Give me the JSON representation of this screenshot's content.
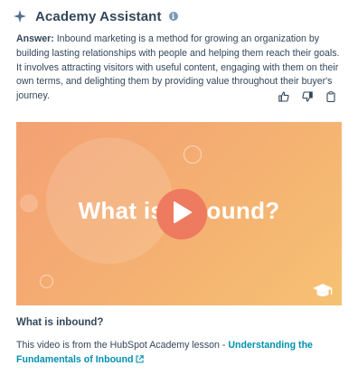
{
  "header": {
    "title": "Academy Assistant",
    "icon": "sparkle-icon",
    "info_icon": "info-icon"
  },
  "answer": {
    "label": "Answer:",
    "text": " Inbound marketing is a method for growing an organization by building lasting relationships with people and helping them reach their goals. It involves attracting visitors with useful content, engaging with them on their own terms, and delighting them by providing value throughout their buyer's journey."
  },
  "feedback": {
    "icons": [
      "thumbs-up-icon",
      "thumbs-down-icon",
      "copy-icon"
    ]
  },
  "video": {
    "title": "What is inbound?",
    "play_icon": "play-icon",
    "logo_icon": "graduation-cap-icon"
  },
  "below_video": {
    "heading": "What is inbound?",
    "source_prefix": "This video is from the HubSpot Academy lesson - ",
    "link_text": "Understanding the Fundamentals of Inbound",
    "link_icon": "external-link-icon"
  },
  "colors": {
    "text": "#33475b",
    "link": "#0091ae",
    "play": "#ee7a5f",
    "gradient_start": "#f3a174",
    "gradient_end": "#f6c173"
  }
}
